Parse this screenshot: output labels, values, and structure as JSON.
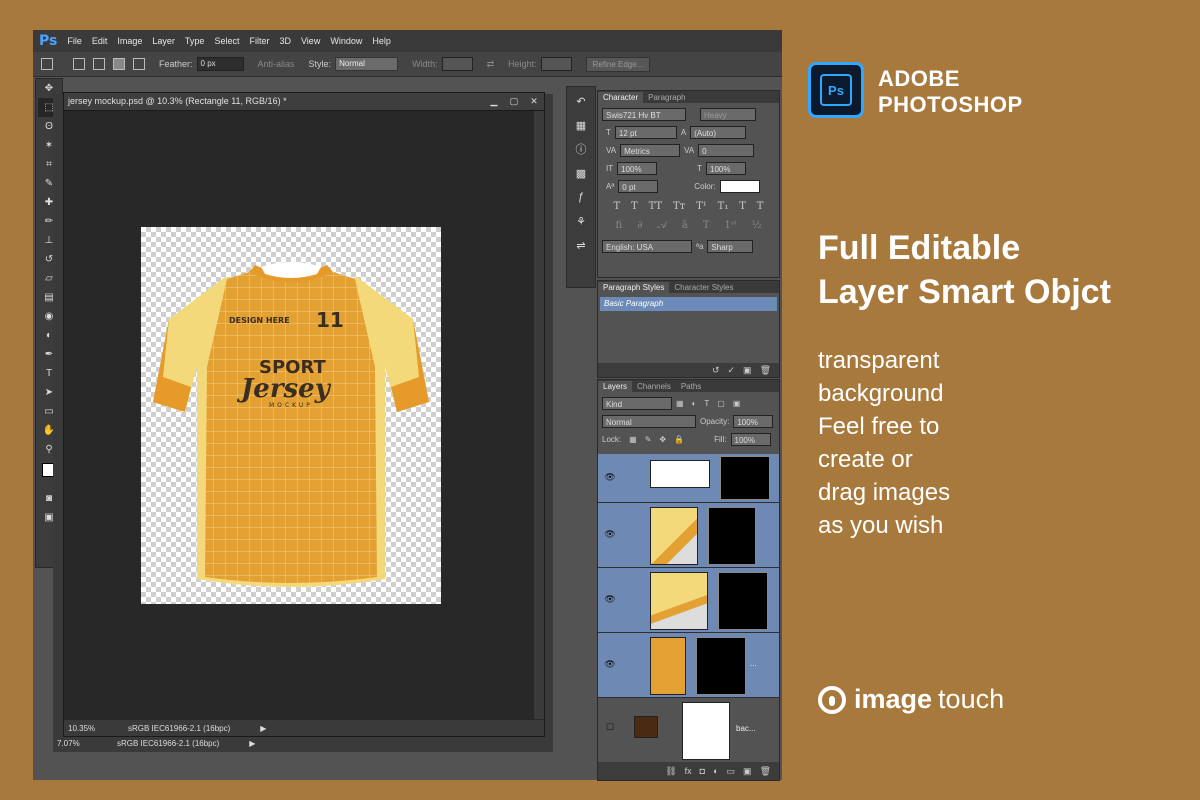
{
  "menubar": {
    "logo": "Ps",
    "items": [
      "File",
      "Edit",
      "Image",
      "Layer",
      "Type",
      "Select",
      "Filter",
      "3D",
      "View",
      "Window",
      "Help"
    ]
  },
  "options": {
    "feather_label": "Feather:",
    "feather_value": "0 px",
    "antialias_label": "Anti-alias",
    "style_label": "Style:",
    "style_value": "Normal",
    "width_label": "Width:",
    "height_label": "Height:",
    "refine_label": "Refine Edge..."
  },
  "document": {
    "title": "jersey mockup.psd @ 10.3% (Rectangle 11, RGB/16) *",
    "zoom": "10.35%",
    "profile": "sRGB IEC61966-2.1 (16bpc)",
    "back_zoom": "7.07%",
    "back_profile": "sRGB IEC61966-2.1 (16bpc)"
  },
  "jersey": {
    "brand": "DESIGN HERE",
    "number": "11",
    "text1": "SPORT",
    "text2": "Jersey",
    "text3": "MOCKUP"
  },
  "character_panel": {
    "tabs": [
      "Character",
      "Paragraph"
    ],
    "font_family": "Swis721 Hv BT",
    "font_style": "Heavy",
    "size": "12 pt",
    "leading": "(Auto)",
    "kerning": "Metrics",
    "tracking": "0",
    "vscale": "100%",
    "hscale": "100%",
    "baseline": "0 pt",
    "color_label": "Color:",
    "language": "English: USA",
    "aa_label": "ªa",
    "antialias": "Sharp"
  },
  "styles_panel": {
    "tabs": [
      "Paragraph Styles",
      "Character Styles"
    ],
    "item": "Basic Paragraph"
  },
  "layers_panel": {
    "tabs": [
      "Layers",
      "Channels",
      "Paths"
    ],
    "kind": "Kind",
    "blend": "Normal",
    "opacity_label": "Opacity:",
    "opacity": "100%",
    "lock_label": "Lock:",
    "fill_label": "Fill:",
    "fill": "100%",
    "row4_name": "...",
    "row5_name": "bac..."
  },
  "promo": {
    "brand_line1": "ADOBE",
    "brand_line2": "PHOTOSHOP",
    "logo_text": "Ps",
    "headline1": "Full Editable",
    "headline2": "Layer Smart Objct",
    "sub1": "transparent",
    "sub2": "background",
    "sub3": "Feel free to",
    "sub4": "create or",
    "sub5": "drag images",
    "sub6": "as you wish",
    "footer_bold": "image",
    "footer_rest": "touch"
  },
  "colors": {
    "background": "#a8793d",
    "jersey_main": "#e3a133",
    "jersey_sleeve": "#f4d97a",
    "ps_blue": "#31a8ff"
  }
}
